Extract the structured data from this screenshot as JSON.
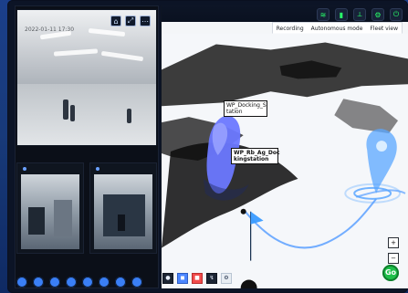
{
  "camera_panel": {
    "main": {
      "timestamp": "2022-01-11 17:30",
      "toolbar_icons": [
        "snapshot-icon",
        "expand-icon",
        "more-icon"
      ]
    },
    "thumbnails": [
      {
        "name": "camera-2"
      },
      {
        "name": "camera-3"
      }
    ],
    "footer_icons": [
      "nav-1",
      "nav-2",
      "nav-3",
      "nav-4",
      "nav-5",
      "nav-6",
      "nav-7",
      "nav-8"
    ]
  },
  "map_panel": {
    "topbar": {
      "title": "",
      "status_icons": [
        "wifi-icon",
        "battery-icon",
        "signal-icon",
        "settings-icon",
        "power-icon"
      ]
    },
    "menu": {
      "items": [
        "Recording",
        "Autonomous mode",
        "Fleet view"
      ]
    },
    "labels": {
      "waypoint_1": "WP_Docking_S\ntation",
      "waypoint_2": "WP_Rb_Ag_Doc\nkingstation"
    },
    "controls": {
      "go_label": "Go",
      "zoom_in": "+",
      "zoom_out": "−"
    },
    "bottom_tools": {
      "tool_1": "●",
      "tool_2": "◼",
      "tool_3": "■",
      "tool_4": "↯",
      "tool_5": "⚙"
    }
  },
  "colors": {
    "accent_green": "#1fbf4a",
    "accent_blue": "#3a7ff6",
    "map_waypoint": "#4aa8ff"
  }
}
